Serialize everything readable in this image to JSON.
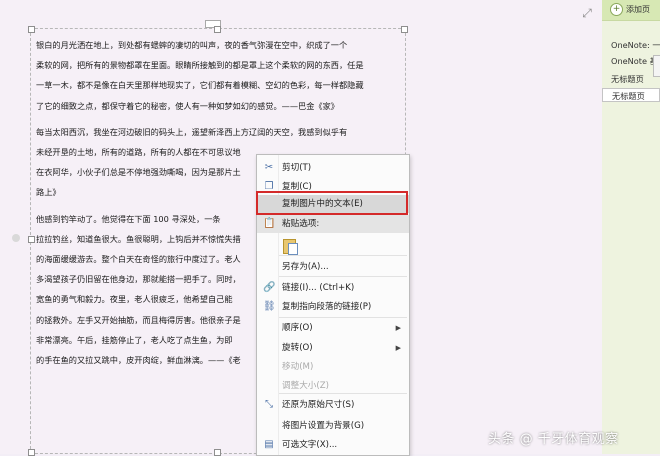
{
  "document": {
    "lines": [
      {
        "text": "银白的月光洒在地上，到处都有蟋蟀的凄切的叫声，夜的香气弥漫在空中，织成了一个"
      },
      {
        "text": "柔软的网，把所有的景物都罩在里面。眼睛所接触到的都是罩上这个柔软的网的东西，任是"
      },
      {
        "text": "一草一木，都不是像在白天里那样地现实了，它们都有着模糊、空幻的色彩，每一样都隐藏"
      },
      {
        "text": "了它的细致之点，都保守着它的秘密，使人有一种如梦如幻的感觉。——巴金《家》"
      },
      {
        "text": "每当太阳西沉，我坐在河边破旧的码头上，遥望新泽西上方辽阔的天空，我感到似乎有",
        "gap": true
      },
      {
        "text": "未经开垦的土地，所有的道路，所有的人都在不可思议地"
      },
      {
        "text": "在衣阿华，小伙子们总是不停地强劲嘶喝，因为是那片土"
      },
      {
        "text": "路上》"
      },
      {
        "text": "他感到钓竿动了。他觉得在下面 100 寻深处，一条",
        "gap": true
      },
      {
        "text": "拉拉钓丝，知道鱼很大。鱼很聪明，上钩后并不惊慌失措"
      },
      {
        "text": "的海面缓缓游去。整个白天在奇怪的旅行中度过了。老人"
      },
      {
        "text": "多渴望孩子仍旧留在他身边，那就能搭一把手了。同时，"
      },
      {
        "text": "宽鱼的勇气和毅力。夜里，老人很疲乏，他希望自己能"
      },
      {
        "text": "的拯救外。左手又开始抽筋，而且梅得厉害。他很亲子是"
      },
      {
        "text": "非常漂亮。午后，挂筋停止了，老人吃了点生鱼，为即"
      },
      {
        "text": "的手在鱼的又拉又跳中，皮开肉绽，鲜血淋漓。——《老"
      }
    ]
  },
  "context_menu": {
    "items": [
      {
        "label": "剪切(T)",
        "icon": "scissors-icon",
        "enabled": true
      },
      {
        "label": "复制(C)",
        "icon": "copy-icon",
        "enabled": true
      },
      {
        "label": "复制图片中的文本(E)",
        "icon": "",
        "enabled": true,
        "highlighted": true
      },
      {
        "label": "粘贴选项:",
        "icon": "paste-icon",
        "enabled": true,
        "header": true
      },
      {
        "label": "另存为(A)...",
        "icon": "",
        "enabled": true
      },
      {
        "label": "链接(I)...  (Ctrl+K)",
        "icon": "link-icon",
        "enabled": true
      },
      {
        "label": "复制指向段落的链接(P)",
        "icon": "link-paragraph-icon",
        "enabled": true
      },
      {
        "label": "顺序(O)",
        "icon": "",
        "enabled": true,
        "submenu": true
      },
      {
        "label": "旋转(O)",
        "icon": "",
        "enabled": true,
        "submenu": true
      },
      {
        "label": "移动(M)",
        "icon": "",
        "enabled": false
      },
      {
        "label": "调整大小(Z)",
        "icon": "",
        "enabled": false
      },
      {
        "label": "还原为原始尺寸(S)",
        "icon": "restore-size-icon",
        "enabled": true
      },
      {
        "label": "将图片设置为背景(G)",
        "icon": "",
        "enabled": true
      },
      {
        "label": "可选文字(X)...",
        "icon": "alt-text-icon",
        "enabled": true
      }
    ]
  },
  "right_panel": {
    "add_page_label": "添加页",
    "pages": [
      {
        "label": "OneNote: 一"
      },
      {
        "label": "OneNote 基"
      },
      {
        "label": "无标题页"
      },
      {
        "label": "无标题页",
        "selected": true
      }
    ]
  },
  "watermark": "头条 @ 千牙体育观察",
  "colors": {
    "highlight_border": "#d42a2a",
    "panel_header": "#d7e8b4",
    "canvas": "#f6f0f7"
  }
}
